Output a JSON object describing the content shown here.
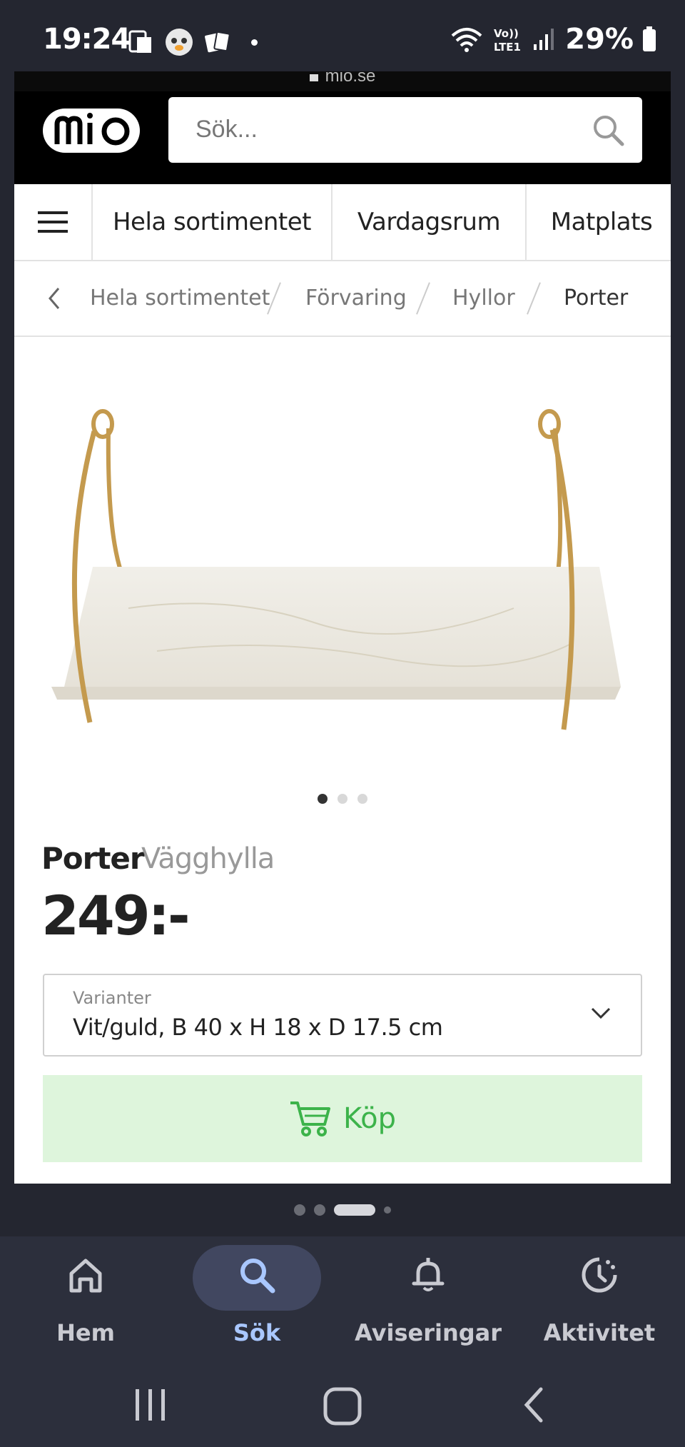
{
  "status_bar": {
    "time": "19:24",
    "battery": "29%"
  },
  "browser": {
    "url": "mio.se"
  },
  "header": {
    "logo_text": "mio",
    "search_placeholder": "Sök..."
  },
  "nav": {
    "items": [
      "Hela sortimentet",
      "Vardagsrum",
      "Matplats"
    ]
  },
  "breadcrumb": {
    "items": [
      "Hela sortimentet",
      "Förvaring",
      "Hyllor",
      "Porter"
    ]
  },
  "product": {
    "name": "Porter",
    "type": "Vägghylla",
    "price": "249:-",
    "variant_label": "Varianter",
    "variant_value": "Vit/guld, B 40 x H 18 x D 17.5 cm",
    "buy_label": "Köp",
    "image_count": 3,
    "image_index": 1
  },
  "bottom_nav": {
    "items": [
      {
        "label": "Hem",
        "icon": "home-icon"
      },
      {
        "label": "Sök",
        "icon": "search-icon"
      },
      {
        "label": "Aviseringar",
        "icon": "bell-icon"
      },
      {
        "label": "Aktivitet",
        "icon": "activity-icon"
      }
    ]
  },
  "colors": {
    "buy_bg": "#def5dc",
    "buy_text": "#3cb34a",
    "header_bg": "#000000",
    "nav_active": "#a9c7ff"
  }
}
